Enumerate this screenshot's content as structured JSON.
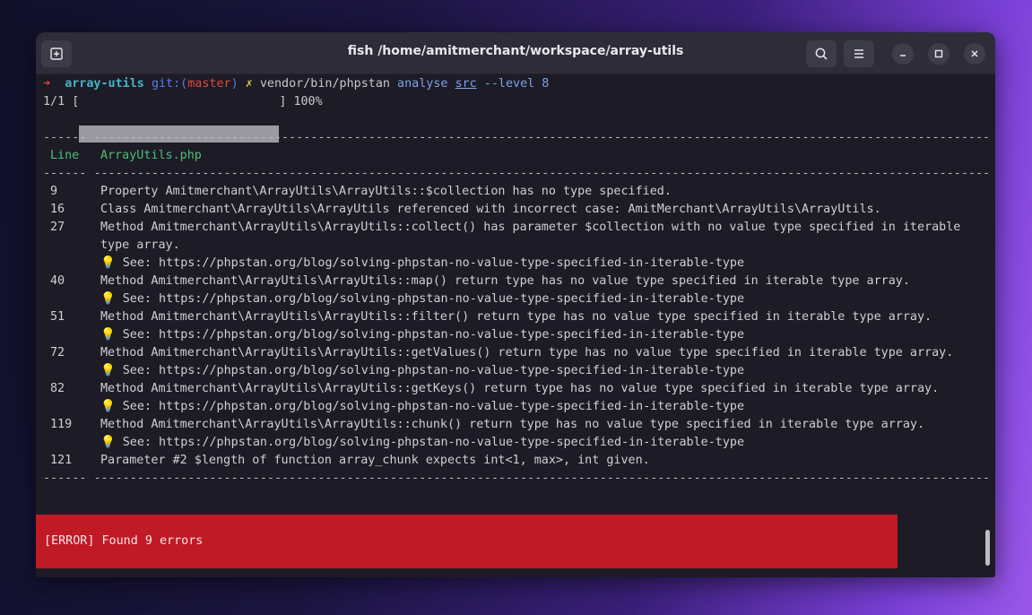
{
  "window": {
    "title": "fish /home/amitmerchant/workspace/array-utils"
  },
  "prompt": {
    "arrow": "➜",
    "directory": "array-utils",
    "git_label": "git:(",
    "branch": "master",
    "git_close": ")",
    "dirty_mark": "✗",
    "command": "vendor/bin/phpstan",
    "args": [
      " analyse ",
      "src",
      " --level 8"
    ]
  },
  "progress": {
    "count": "1/1 [",
    "close": "]",
    "percent": "100%",
    "fraction": 1.0
  },
  "report": {
    "separator_a": "------",
    "separator_b": "----------------------------------------------------------------------------------------------------------------------------",
    "header_line": "Line",
    "header_file": "ArrayUtils.php",
    "rows": [
      {
        "line": "9",
        "msg": "Property Amitmerchant\\ArrayUtils\\ArrayUtils::$collection has no type specified."
      },
      {
        "line": "16",
        "msg": "Class Amitmerchant\\ArrayUtils\\ArrayUtils referenced with incorrect case: AmitMerchant\\ArrayUtils\\ArrayUtils."
      },
      {
        "line": "27",
        "msg": "Method Amitmerchant\\ArrayUtils\\ArrayUtils::collect() has parameter $collection with no value type specified in iterable"
      },
      {
        "line": "",
        "msg": "type array."
      },
      {
        "line": "",
        "msg": "💡 See: https://phpstan.org/blog/solving-phpstan-no-value-type-specified-in-iterable-type"
      },
      {
        "line": "40",
        "msg": "Method Amitmerchant\\ArrayUtils\\ArrayUtils::map() return type has no value type specified in iterable type array."
      },
      {
        "line": "",
        "msg": "💡 See: https://phpstan.org/blog/solving-phpstan-no-value-type-specified-in-iterable-type"
      },
      {
        "line": "51",
        "msg": "Method Amitmerchant\\ArrayUtils\\ArrayUtils::filter() return type has no value type specified in iterable type array."
      },
      {
        "line": "",
        "msg": "💡 See: https://phpstan.org/blog/solving-phpstan-no-value-type-specified-in-iterable-type"
      },
      {
        "line": "72",
        "msg": "Method Amitmerchant\\ArrayUtils\\ArrayUtils::getValues() return type has no value type specified in iterable type array."
      },
      {
        "line": "",
        "msg": "💡 See: https://phpstan.org/blog/solving-phpstan-no-value-type-specified-in-iterable-type"
      },
      {
        "line": "82",
        "msg": "Method Amitmerchant\\ArrayUtils\\ArrayUtils::getKeys() return type has no value type specified in iterable type array."
      },
      {
        "line": "",
        "msg": "💡 See: https://phpstan.org/blog/solving-phpstan-no-value-type-specified-in-iterable-type"
      },
      {
        "line": "119",
        "msg": "Method Amitmerchant\\ArrayUtils\\ArrayUtils::chunk() return type has no value type specified in iterable type array."
      },
      {
        "line": "",
        "msg": "💡 See: https://phpstan.org/blog/solving-phpstan-no-value-type-specified-in-iterable-type"
      },
      {
        "line": "121",
        "msg": "Parameter #2 $length of function array_chunk expects int<1, max>, int given."
      }
    ]
  },
  "error": {
    "text": "[ERROR] Found 9 errors"
  },
  "colors": {
    "prompt_arrow": "#e0483e",
    "directory": "#4ab3c7",
    "git": "#5a7ee6",
    "branch": "#e0483e",
    "dirty": "#e3c15a",
    "command": "#c8c8ce",
    "header": "#4fbd78",
    "error_bg": "#c11a27"
  }
}
